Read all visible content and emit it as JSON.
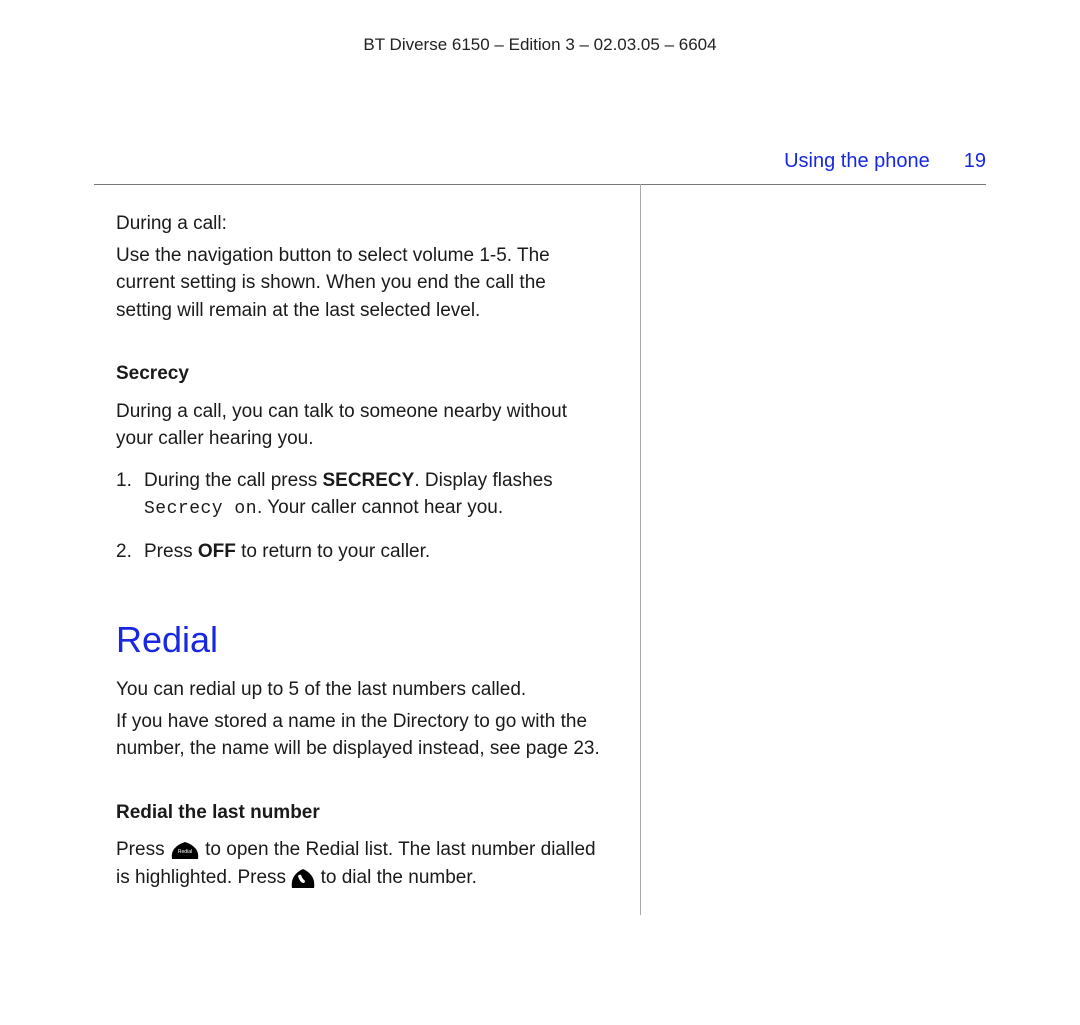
{
  "running_head": "BT Diverse 6150 – Edition 3 – 02.03.05 – 6604",
  "chapter_title": "Using the phone",
  "page_number": "19",
  "during_call_lead": "During a call:",
  "volume_para": "Use the navigation button to select volume 1-5. The current setting is shown. When you end the call the setting will remain at the last selected level.",
  "secrecy": {
    "heading": "Secrecy",
    "intro": "During a call, you can talk to someone nearby without your caller hearing you.",
    "step1_a": "During the call press ",
    "step1_key": "SECRECY",
    "step1_b": ". Display flashes ",
    "step1_lcd": "Secrecy on",
    "step1_c": ". Your caller cannot hear you.",
    "step2_a": "Press ",
    "step2_key": "OFF",
    "step2_b": " to return to your caller."
  },
  "redial": {
    "heading": "Redial",
    "para1": "You can redial up to 5 of the last numbers called.",
    "para2": "If you have stored a name in the Directory to go with the number, the name will be displayed instead, see page 23.",
    "last_heading": "Redial the last number",
    "press1": "Press ",
    "after_icon1": " to open the Redial list. The last number dialled is highlighted. Press ",
    "after_icon2": " to dial the number."
  }
}
